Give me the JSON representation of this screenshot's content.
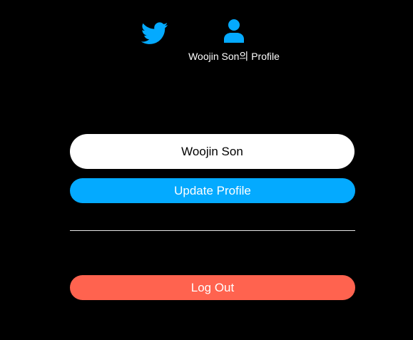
{
  "nav": {
    "home_icon": "twitter-bird-icon",
    "profile_icon": "user-icon",
    "profile_label": "Woojin Son의 Profile"
  },
  "form": {
    "display_name_value": "Woojin Son",
    "update_label": "Update Profile"
  },
  "logout_label": "Log Out",
  "colors": {
    "background": "#000000",
    "accent": "#04aaff",
    "danger": "#ff634f",
    "input_bg": "#ffffff"
  }
}
